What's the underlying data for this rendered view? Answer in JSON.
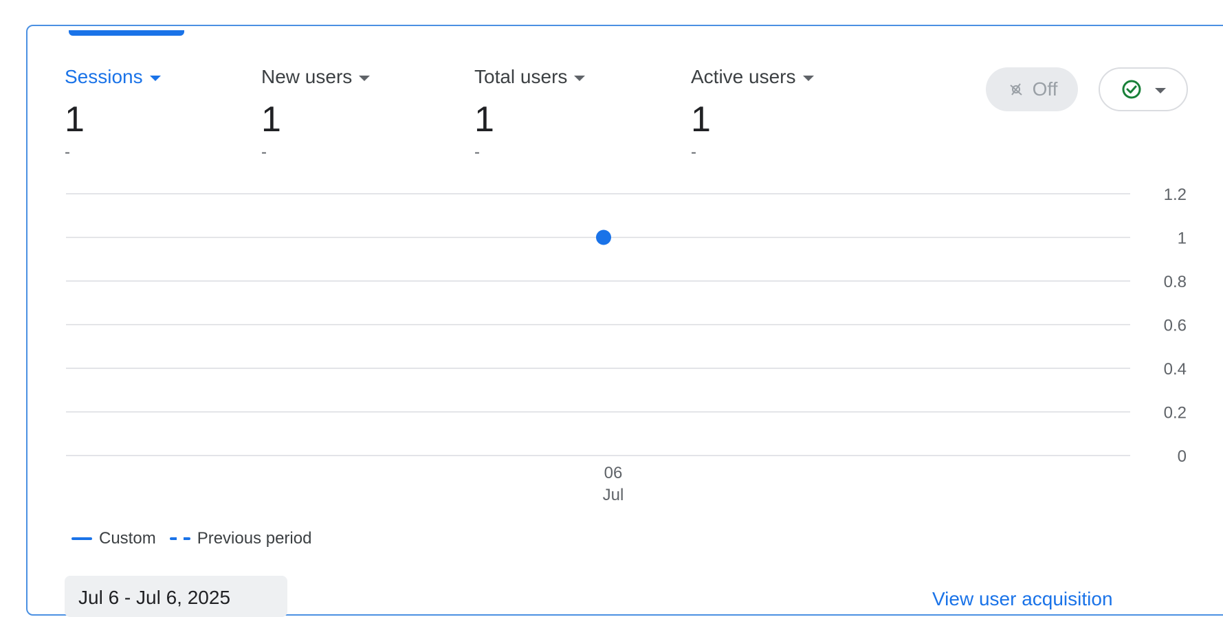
{
  "metrics": [
    {
      "label": "Sessions",
      "value": "1",
      "change": "-",
      "active": true
    },
    {
      "label": "New users",
      "value": "1",
      "change": "-",
      "active": false
    },
    {
      "label": "Total users",
      "value": "1",
      "change": "-",
      "active": false
    },
    {
      "label": "Active users",
      "value": "1",
      "change": "-",
      "active": false
    }
  ],
  "controls": {
    "toggle_label": "Off",
    "toggle_icon": "auto-awesome-off-icon",
    "status_icon": "check-circle-icon",
    "dropdown_icon": "chevron-down-icon"
  },
  "legend": {
    "current_label": "Custom",
    "previous_label": "Previous period"
  },
  "date_button": {
    "label": "Jul 6 - Jul 6, 2025"
  },
  "footer": {
    "link_text": "View user acquisition"
  },
  "colors": {
    "accent": "#1a73e8",
    "grid": "#dadce0",
    "muted": "#5f6368"
  },
  "chart_data": {
    "type": "line",
    "title": "",
    "xlabel": "",
    "ylabel": "",
    "x": [
      "06\nJul"
    ],
    "x_tick_labels": [
      "06",
      "Jul"
    ],
    "series": [
      {
        "name": "Custom",
        "values": [
          1
        ]
      }
    ],
    "ylim": [
      0,
      1.2
    ],
    "y_ticks": [
      "1.2",
      "1",
      "0.8",
      "0.6",
      "0.4",
      "0.2",
      "0"
    ],
    "grid": true,
    "legend_position": "bottom-left"
  }
}
